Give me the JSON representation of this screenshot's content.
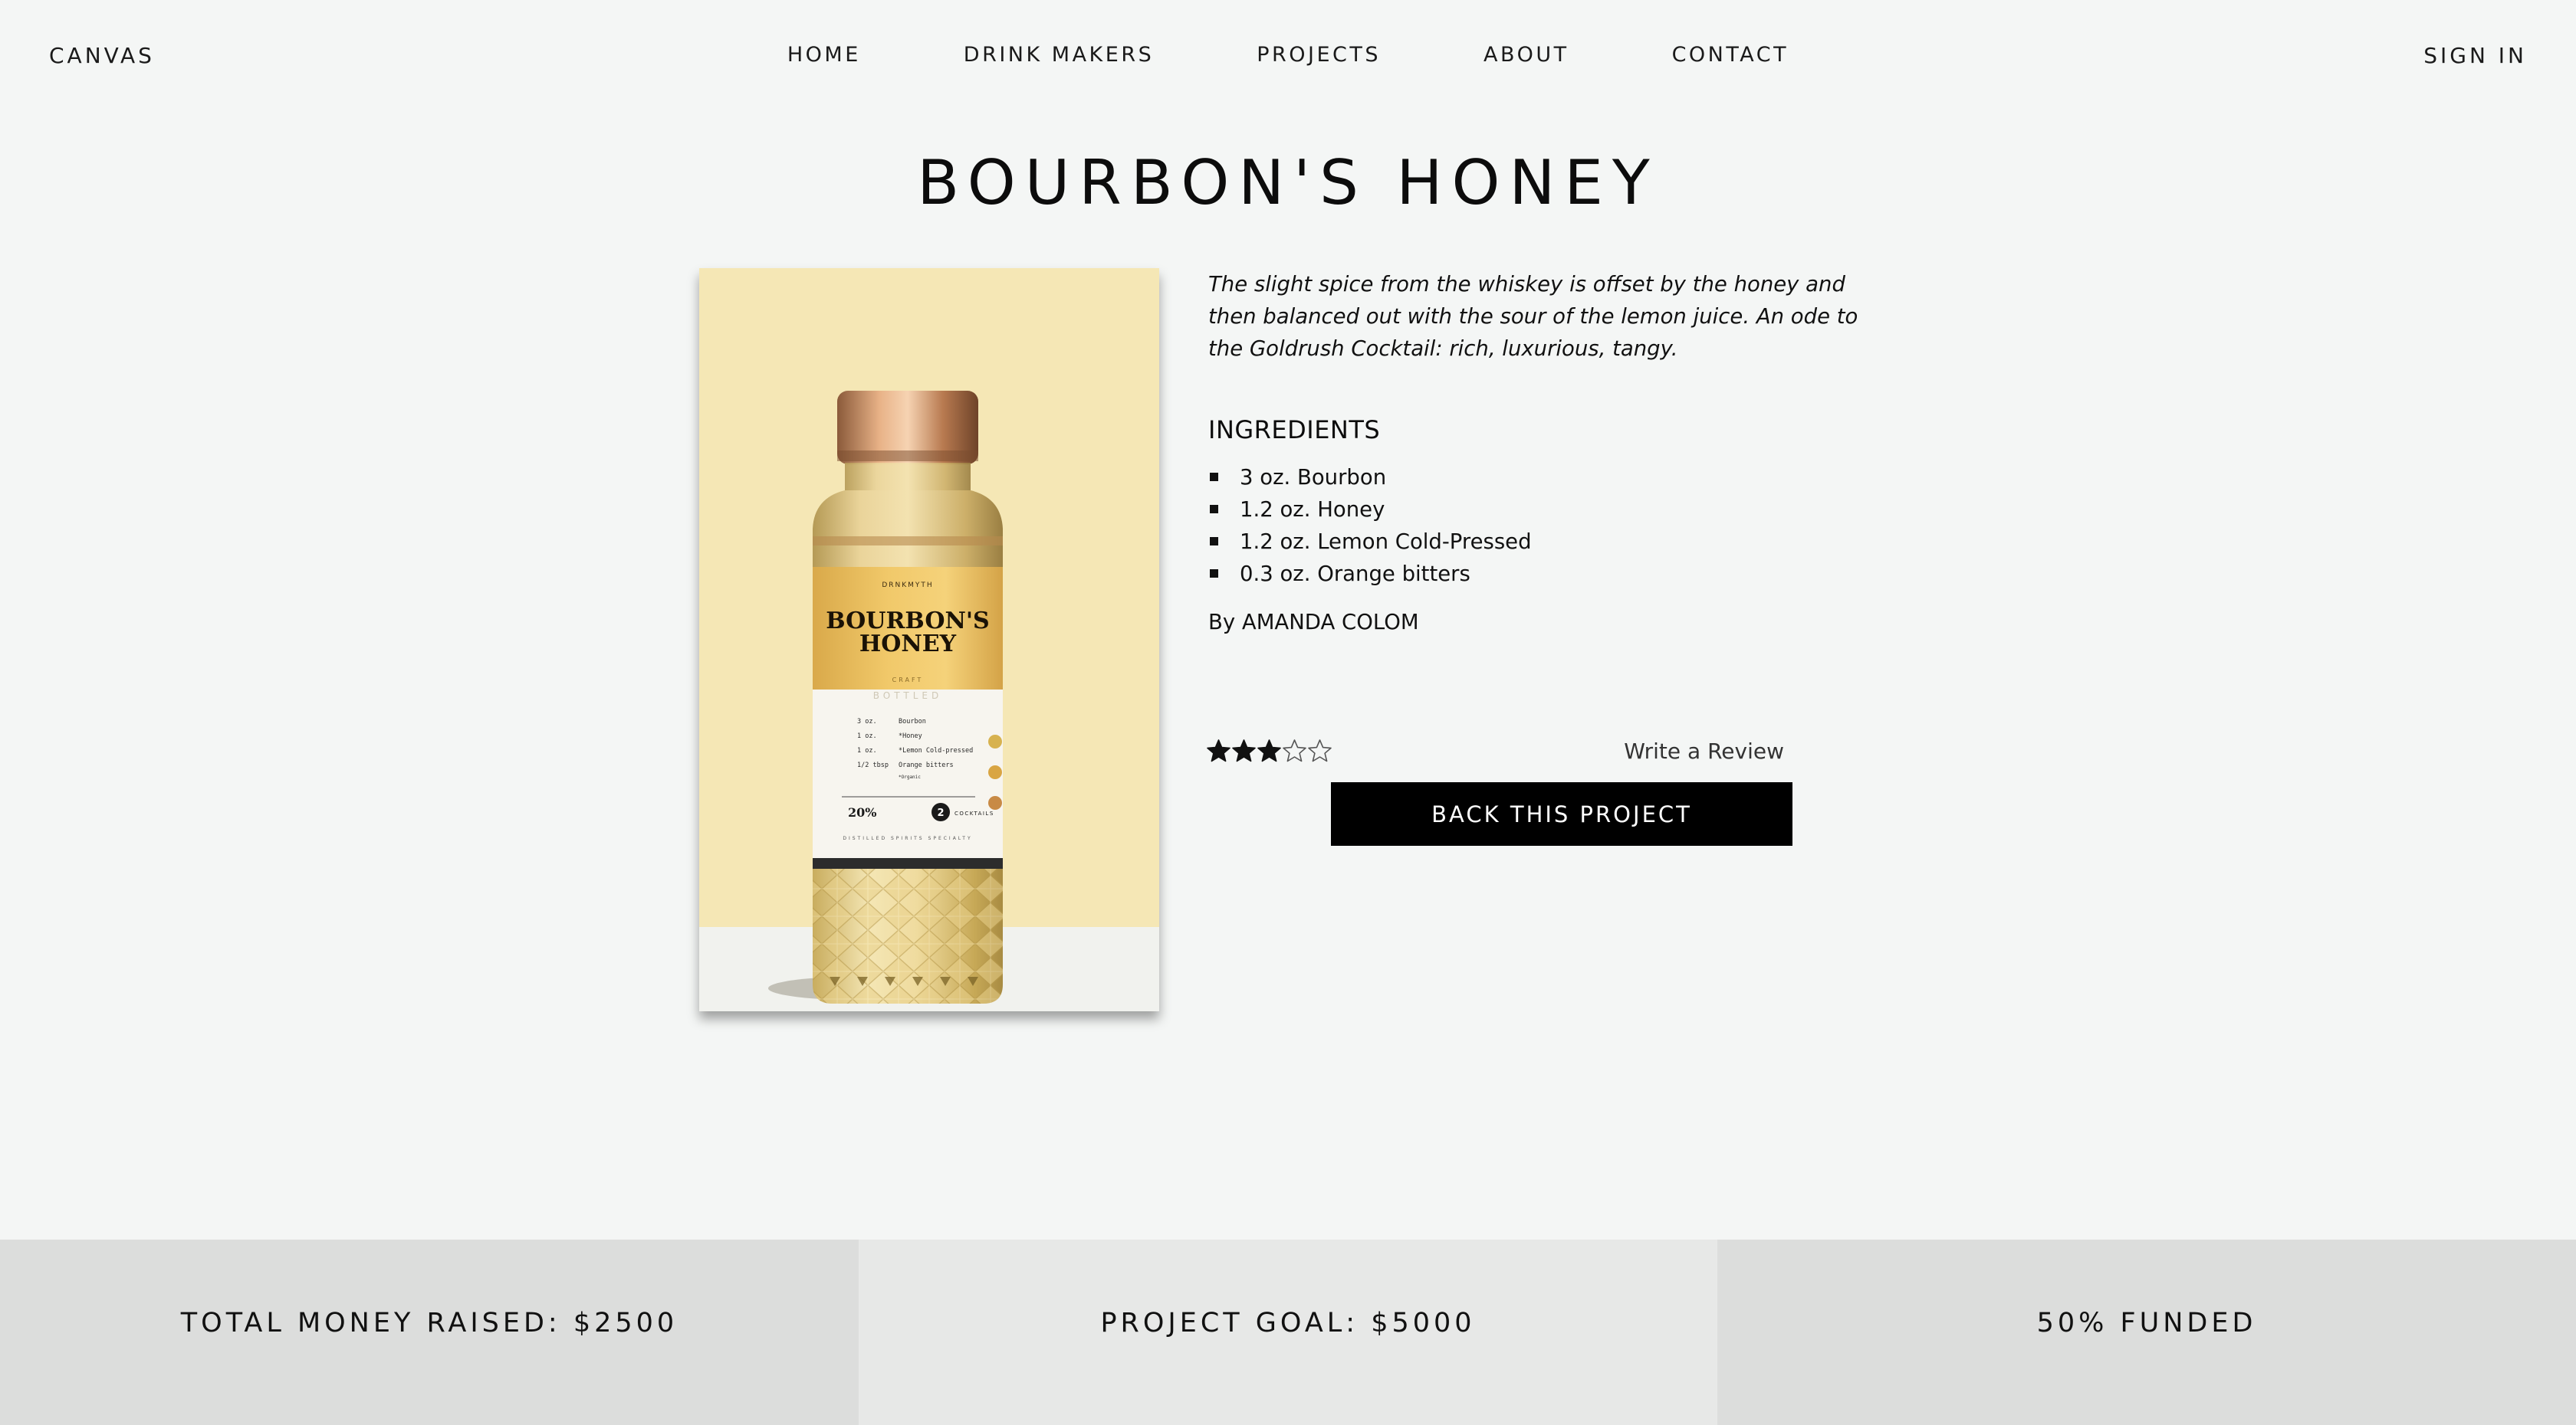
{
  "nav": {
    "brand": "CANVAS",
    "links": [
      {
        "label": "HOME"
      },
      {
        "label": "DRINK MAKERS"
      },
      {
        "label": "PROJECTS"
      },
      {
        "label": "ABOUT"
      },
      {
        "label": "CONTACT"
      }
    ],
    "sign_in": "SIGN IN"
  },
  "project": {
    "title": "BOURBON'S HONEY",
    "description": "The slight spice from the whiskey is offset by the honey and then balanced out with the sour of the lemon juice. An ode to the Goldrush Cocktail: rich, luxurious, tangy.",
    "ingredients_heading": "INGREDIENTS",
    "ingredients": [
      "3 oz. Bourbon",
      "1.2 oz. Honey",
      "1.2 oz. Lemon Cold-Pressed",
      "0.3 oz. Orange bitters"
    ],
    "author": "By AMANDA COLOM",
    "rating": {
      "value": 3,
      "max": 5
    },
    "write_review": "Write a Review",
    "back_button": "BACK THIS PROJECT"
  },
  "image": {
    "label_brand": "DRNKMYTH",
    "label_title_line1": "BOURBON'S",
    "label_title_line2": "HONEY",
    "label_sub1": "CRAFT",
    "label_sub2": "BOTTLED",
    "label_rows": [
      {
        "qty": "3 oz.",
        "name": "Bourbon"
      },
      {
        "qty": "1 oz.",
        "name": "*Honey"
      },
      {
        "qty": "1 oz.",
        "name": "*Lemon Cold-pressed"
      },
      {
        "qty": "1/2 tbsp",
        "name": "Orange bitters"
      }
    ],
    "label_note": "*Organic",
    "label_abv": "20%",
    "label_count": "2",
    "label_cocktails": "COCKTAILS",
    "label_footer": "DISTILLED SPIRITS SPECIALTY",
    "colors": {
      "background": "#f5e7b5",
      "label_yellow": "#ecc35a",
      "cap": "#c98a5a",
      "liquid": "#e6c97a"
    }
  },
  "stats": {
    "raised": "TOTAL MONEY RAISED: $2500",
    "goal": "PROJECT GOAL: $5000",
    "funded": "50% FUNDED"
  },
  "colors": {
    "page_bg": "#f4f6f5",
    "button_bg": "#000000",
    "stat_dark": "#dcdddc",
    "stat_light": "#e7e8e7"
  }
}
